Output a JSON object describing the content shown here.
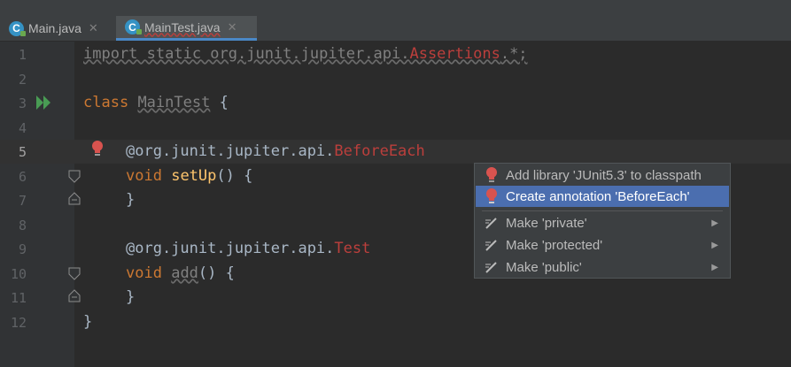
{
  "tabs": [
    {
      "label": "Main.java",
      "icon": "java-class-icon",
      "active": false
    },
    {
      "label": "MainTest.java",
      "icon": "java-test-class-icon",
      "active": true
    }
  ],
  "line_numbers": [
    "1",
    "2",
    "3",
    "4",
    "5",
    "6",
    "7",
    "8",
    "9",
    "10",
    "11",
    "12"
  ],
  "code": {
    "l1_import": "import static org.junit.jupiter.api.",
    "l1_assertions": "Assertions",
    "l1_rest": ".*;",
    "l3_class": "class",
    "l3_name": "MainTest",
    "l3_brace": "{",
    "l5_ann": "@org.junit.jupiter.api.",
    "l5_name": "BeforeEach",
    "l6_void": "void",
    "l6_fn": "setUp",
    "l6_rest": "() {",
    "l7": "}",
    "l9_ann": "@org.junit.jupiter.api.",
    "l9_name": "Test",
    "l10_void": "void",
    "l10_fn": "add",
    "l10_rest": "() {",
    "l11": "}",
    "l12": "}"
  },
  "popup": {
    "items": [
      {
        "label": "Add library 'JUnit5.3' to classpath",
        "icon": "red-bulb-icon"
      },
      {
        "label": "Create annotation 'BeforeEach'",
        "icon": "red-bulb-icon",
        "selected": true
      },
      {
        "label": "Make 'private'",
        "icon": "intention-icon"
      },
      {
        "label": "Make 'protected'",
        "icon": "intention-icon"
      },
      {
        "label": "Make 'public'",
        "icon": "intention-icon"
      }
    ]
  },
  "colors": {
    "background": "#2b2b2b",
    "keyword": "#cc7832",
    "error": "#bc3f3c",
    "selection": "#4b6eaf"
  }
}
